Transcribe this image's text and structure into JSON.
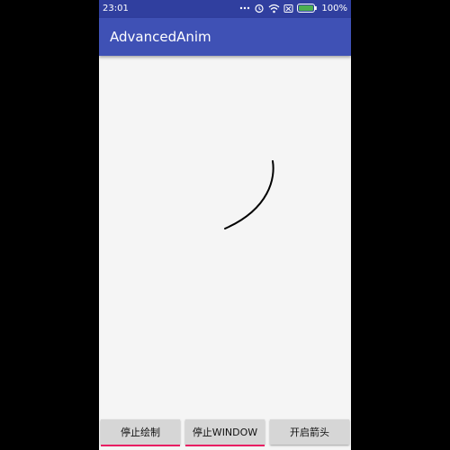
{
  "status": {
    "time": "23:01",
    "battery_percent": "100%",
    "icons": [
      "notification-dots-icon",
      "alarm-icon",
      "wifi-icon",
      "sim-icon",
      "battery-icon"
    ]
  },
  "app": {
    "title": "AdvancedAnim",
    "primary_color": "#3f51b5",
    "status_bar_color": "#303f9f",
    "accent_color": "#e91e63"
  },
  "buttons": {
    "stop_draw": "停止绘制",
    "stop_window": "停止WINDOW",
    "open_arrow": "开启箭头"
  }
}
